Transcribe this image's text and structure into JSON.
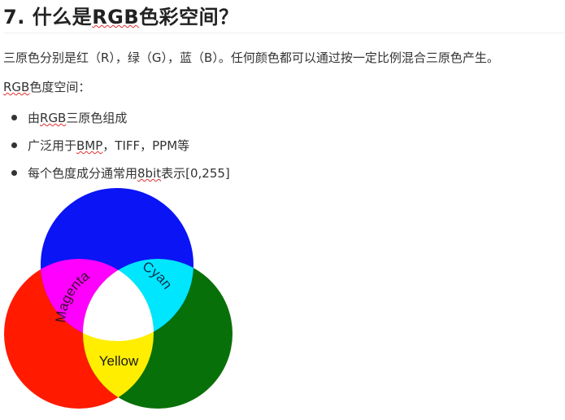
{
  "heading": {
    "number": "7.",
    "before": "什么是",
    "term": "RGB",
    "after": "色彩空间？"
  },
  "intro": "三原色分别是红（R），绿（G），蓝（B）。任何颜色都可以通过按一定比例混合三原色产生。",
  "subheading": {
    "term": "RGB",
    "rest": "色度空间："
  },
  "bullets": [
    {
      "before": "由",
      "term": "RGB",
      "after": "三原色组成"
    },
    {
      "before": "广泛用于",
      "term": "BMP",
      "after": "，TIFF，PPM等"
    },
    {
      "before": "每个色度成分通常用",
      "term": "8bit",
      "after": "表示[0,255]"
    }
  ],
  "diagram": {
    "labels": {
      "magenta": "Magenta",
      "cyan": "Cyan",
      "yellow": "Yellow"
    },
    "colors": {
      "red": "#ff1a00",
      "green": "#087008",
      "blue": "#0a14f5",
      "magenta": "#ff00ff",
      "cyan": "#00e6ff",
      "yellow": "#ffee00",
      "white": "#ffffff"
    }
  }
}
